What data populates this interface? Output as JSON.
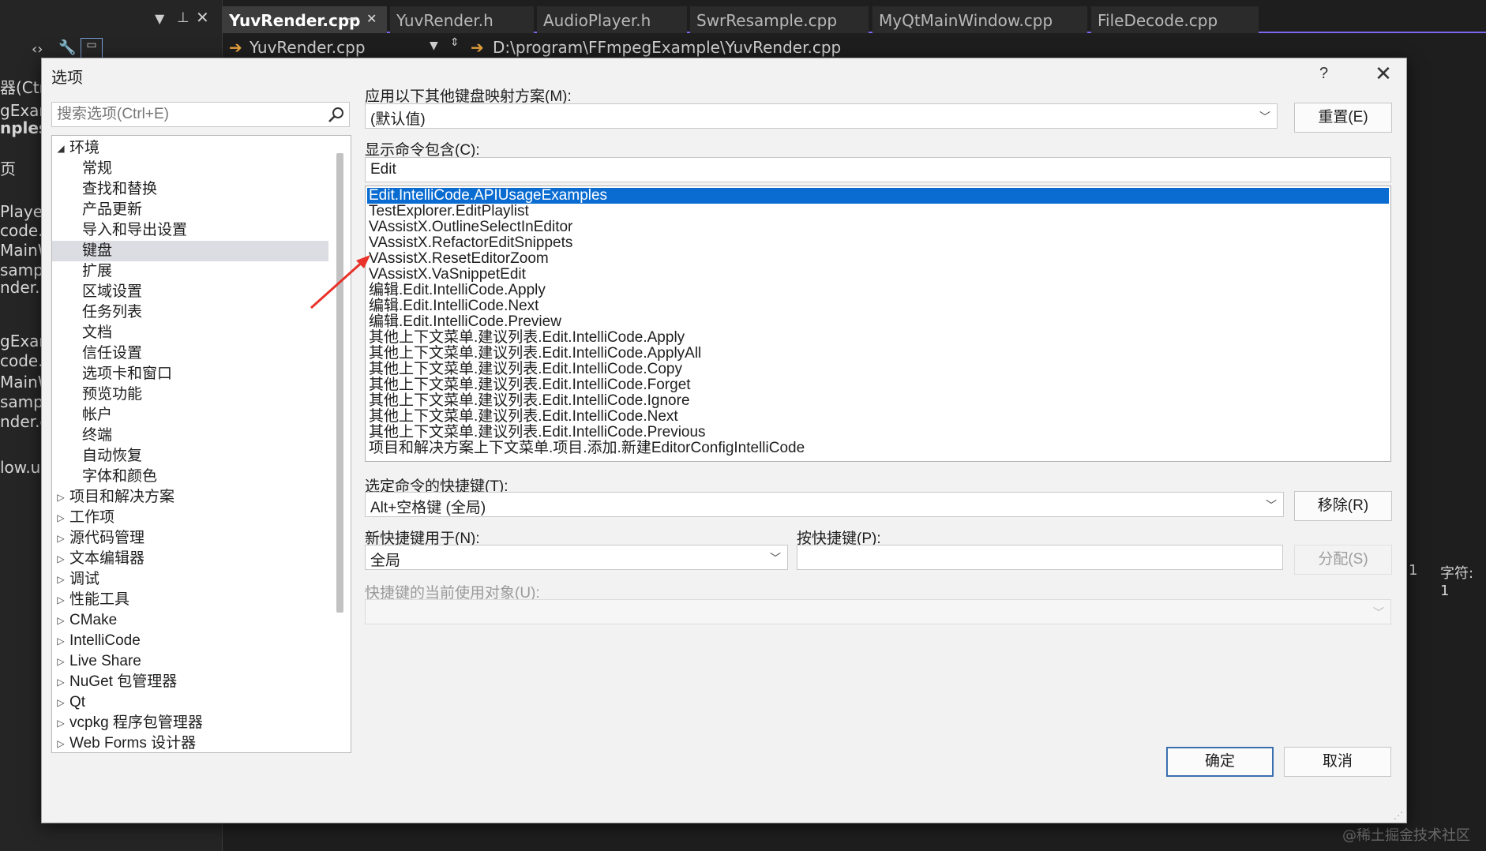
{
  "ide": {
    "left_panel_rows": [
      "器(Ctr",
      "gExam",
      "nples",
      "页",
      "Player.",
      "code.h",
      "MainW",
      "sample",
      "nder.h",
      "gExam",
      "code.c",
      "MainW",
      "sample",
      "nder.cp",
      "low.ui"
    ],
    "tabs": [
      {
        "label": "YuvRender.cpp",
        "active": true
      },
      {
        "label": "YuvRender.h"
      },
      {
        "label": "AudioPlayer.h"
      },
      {
        "label": "SwrResample.cpp"
      },
      {
        "label": "MyQtMainWindow.cpp"
      },
      {
        "label": "FileDecode.cpp"
      }
    ],
    "nav_file": "YuvRender.cpp",
    "nav_path": "D:\\program\\FFmpegExample\\YuvRender.cpp",
    "status_line": "1",
    "status_char": "字符: 1",
    "watermark": "@稀土掘金技术社区"
  },
  "dialog": {
    "title": "选项",
    "help": "?",
    "close": "✕",
    "search_placeholder": "搜索选项(Ctrl+E)",
    "tree": [
      {
        "label": "环境",
        "level": 0,
        "expanded": true
      },
      {
        "label": "常规",
        "level": 1
      },
      {
        "label": "查找和替换",
        "level": 1
      },
      {
        "label": "产品更新",
        "level": 1
      },
      {
        "label": "导入和导出设置",
        "level": 1
      },
      {
        "label": "键盘",
        "level": 1,
        "selected": true
      },
      {
        "label": "扩展",
        "level": 1
      },
      {
        "label": "区域设置",
        "level": 1
      },
      {
        "label": "任务列表",
        "level": 1
      },
      {
        "label": "文档",
        "level": 1
      },
      {
        "label": "信任设置",
        "level": 1
      },
      {
        "label": "选项卡和窗口",
        "level": 1
      },
      {
        "label": "预览功能",
        "level": 1
      },
      {
        "label": "帐户",
        "level": 1
      },
      {
        "label": "终端",
        "level": 1
      },
      {
        "label": "自动恢复",
        "level": 1
      },
      {
        "label": "字体和颜色",
        "level": 1
      },
      {
        "label": "项目和解决方案",
        "level": 0,
        "expanded": false
      },
      {
        "label": "工作项",
        "level": 0,
        "expanded": false
      },
      {
        "label": "源代码管理",
        "level": 0,
        "expanded": false
      },
      {
        "label": "文本编辑器",
        "level": 0,
        "expanded": false
      },
      {
        "label": "调试",
        "level": 0,
        "expanded": false
      },
      {
        "label": "性能工具",
        "level": 0,
        "expanded": false
      },
      {
        "label": "CMake",
        "level": 0,
        "expanded": false
      },
      {
        "label": "IntelliCode",
        "level": 0,
        "expanded": false
      },
      {
        "label": "Live Share",
        "level": 0,
        "expanded": false
      },
      {
        "label": "NuGet 包管理器",
        "level": 0,
        "expanded": false
      },
      {
        "label": "Qt",
        "level": 0,
        "expanded": false
      },
      {
        "label": "vcpkg 程序包管理器",
        "level": 0,
        "expanded": false
      },
      {
        "label": "Web Forms 设计器",
        "level": 0,
        "expanded": false
      }
    ],
    "mapping_label": "应用以下其他键盘映射方案(M):",
    "mapping_value": "(默认值)",
    "reset_button": "重置(E)",
    "show_commands_label": "显示命令包含(C):",
    "show_commands_value": "Edit",
    "commands": [
      {
        "label": "Edit.IntelliCode.APIUsageExamples",
        "selected": true
      },
      {
        "label": "TestExplorer.EditPlaylist"
      },
      {
        "label": "VAssistX.OutlineSelectInEditor"
      },
      {
        "label": "VAssistX.RefactorEditSnippets"
      },
      {
        "label": "VAssistX.ResetEditorZoom"
      },
      {
        "label": "VAssistX.VaSnippetEdit"
      },
      {
        "label": "编辑.Edit.IntelliCode.Apply"
      },
      {
        "label": "编辑.Edit.IntelliCode.Next"
      },
      {
        "label": "编辑.Edit.IntelliCode.Preview"
      },
      {
        "label": "其他上下文菜单.建议列表.Edit.IntelliCode.Apply"
      },
      {
        "label": "其他上下文菜单.建议列表.Edit.IntelliCode.ApplyAll"
      },
      {
        "label": "其他上下文菜单.建议列表.Edit.IntelliCode.Copy"
      },
      {
        "label": "其他上下文菜单.建议列表.Edit.IntelliCode.Forget"
      },
      {
        "label": "其他上下文菜单.建议列表.Edit.IntelliCode.Ignore"
      },
      {
        "label": "其他上下文菜单.建议列表.Edit.IntelliCode.Next"
      },
      {
        "label": "其他上下文菜单.建议列表.Edit.IntelliCode.Previous"
      },
      {
        "label": "项目和解决方案上下文菜单.项目.添加.新建EditorConfigIntelliCode"
      }
    ],
    "shortcut_label": "选定命令的快捷键(T):",
    "shortcut_value": "Alt+空格键 (全局)",
    "remove_button": "移除(R)",
    "new_shortcut_scope_label": "新快捷键用于(N):",
    "new_shortcut_scope_value": "全局",
    "press_keys_label": "按快捷键(P):",
    "press_keys_value": "",
    "assign_button": "分配(S)",
    "current_usage_label": "快捷键的当前使用对象(U):",
    "current_usage_value": "",
    "ok_button": "确定",
    "cancel_button": "取消"
  },
  "colors": {
    "selection_blue": "#0a6cd1",
    "tree_selected": "#dcdce3",
    "annotation_arrow": "#e8322a",
    "tab_accent": "#7b68ee"
  }
}
